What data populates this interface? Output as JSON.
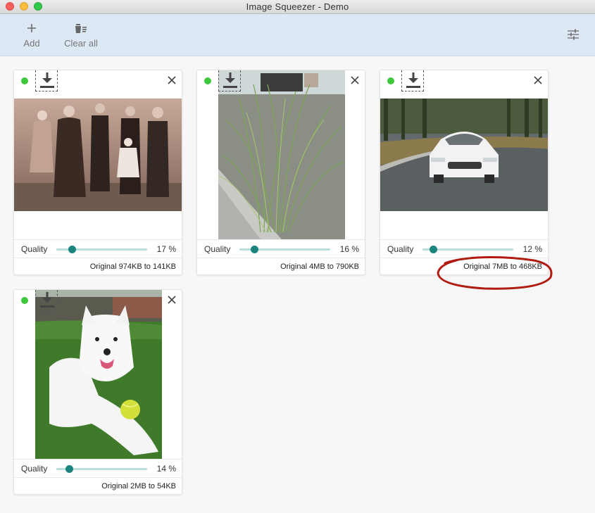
{
  "window": {
    "title": "Image Squeezer - Demo"
  },
  "toolbar": {
    "add_label": "Add",
    "add_icon": "plus-icon",
    "clear_label": "Clear all",
    "clear_icon": "trash-list-icon",
    "settings_icon": "sliders-icon"
  },
  "colors": {
    "toolbar_bg": "#dde8f5",
    "status_ok": "#3ec83e",
    "slider_track": "#b7dede",
    "slider_thumb": "#1b857d",
    "annotation": "#b01c10"
  },
  "cards": [
    {
      "image": "sepia-family-portrait",
      "quality_label": "Quality",
      "quality": 17,
      "quality_text": "17 %",
      "size_text": "Original 974KB to 141KB"
    },
    {
      "image": "ornamental-grass",
      "quality_label": "Quality",
      "quality": 16,
      "quality_text": "16 %",
      "size_text": "Original 4MB to 790KB"
    },
    {
      "image": "white-sedan",
      "quality_label": "Quality",
      "quality": 12,
      "quality_text": "12 %",
      "size_text": "Original 7MB to 468KB"
    },
    {
      "image": "white-dog-with-ball",
      "quality_label": "Quality",
      "quality": 14,
      "quality_text": "14 %",
      "size_text": "Original 2MB to 54KB"
    }
  ]
}
